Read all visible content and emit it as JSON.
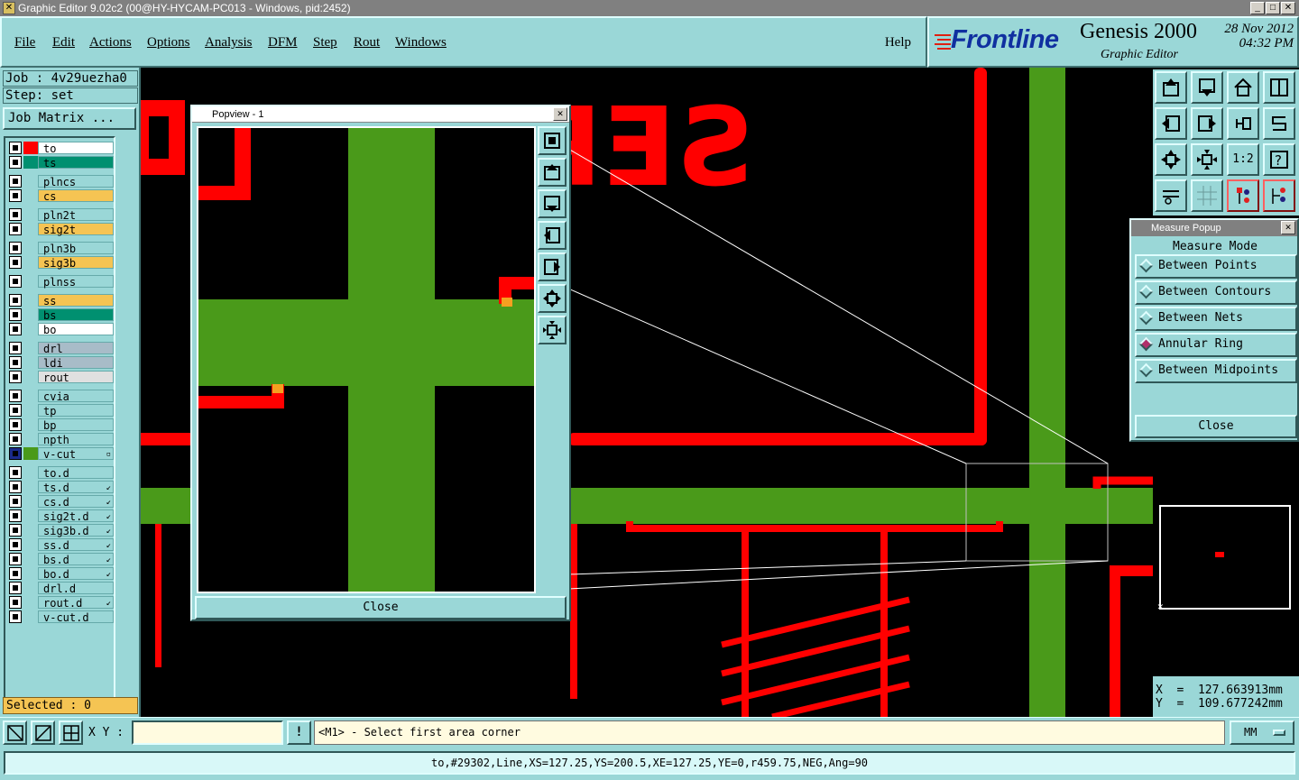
{
  "window": {
    "title": "Graphic Editor 9.02c2 (00@HY-HYCAM-PC013 - Windows, pid:2452)"
  },
  "menu": {
    "items": [
      "File",
      "Edit",
      "Actions",
      "Options",
      "Analysis",
      "DFM",
      "Step",
      "Rout",
      "Windows"
    ],
    "help": "Help"
  },
  "brand": {
    "logo": "Frontline",
    "product": "Genesis 2000",
    "subtitle": "Graphic Editor",
    "date": "28 Nov 2012",
    "time": "04:32 PM"
  },
  "job": {
    "job_line": "Job : 4v29uezha0",
    "step_line": "Step: set",
    "matrix_button": "Job Matrix ..."
  },
  "layers": [
    {
      "name": "to",
      "color": "#ff0000",
      "bg": "#ffffff",
      "mark": ""
    },
    {
      "name": "ts",
      "color": "#009070",
      "bg": "#009070",
      "mark": ""
    },
    {
      "name": "plncs",
      "color": "#9ad7d7",
      "bg": "#9ad7d7",
      "mark": ""
    },
    {
      "name": "cs",
      "color": "#9ad7d7",
      "bg": "#f5c453",
      "mark": ""
    },
    {
      "name": "pln2t",
      "color": "#9ad7d7",
      "bg": "#9ad7d7",
      "mark": ""
    },
    {
      "name": "sig2t",
      "color": "#9ad7d7",
      "bg": "#f5c453",
      "mark": ""
    },
    {
      "name": "pln3b",
      "color": "#9ad7d7",
      "bg": "#9ad7d7",
      "mark": ""
    },
    {
      "name": "sig3b",
      "color": "#9ad7d7",
      "bg": "#f5c453",
      "mark": ""
    },
    {
      "name": "plnss",
      "color": "#9ad7d7",
      "bg": "#9ad7d7",
      "mark": ""
    },
    {
      "name": "ss",
      "color": "#9ad7d7",
      "bg": "#f5c453",
      "mark": ""
    },
    {
      "name": "bs",
      "color": "#9ad7d7",
      "bg": "#009070",
      "mark": ""
    },
    {
      "name": "bo",
      "color": "#9ad7d7",
      "bg": "#ffffff",
      "mark": ""
    },
    {
      "name": "drl",
      "color": "#9ad7d7",
      "bg": "#a8bcc8",
      "mark": ""
    },
    {
      "name": "ldi",
      "color": "#9ad7d7",
      "bg": "#a8bcc8",
      "mark": ""
    },
    {
      "name": "rout",
      "color": "#9ad7d7",
      "bg": "#e0e0e0",
      "mark": ""
    },
    {
      "name": "cvia",
      "color": "#9ad7d7",
      "bg": "#9ad7d7",
      "mark": ""
    },
    {
      "name": "tp",
      "color": "#9ad7d7",
      "bg": "#9ad7d7",
      "mark": ""
    },
    {
      "name": "bp",
      "color": "#9ad7d7",
      "bg": "#9ad7d7",
      "mark": ""
    },
    {
      "name": "npth",
      "color": "#9ad7d7",
      "bg": "#9ad7d7",
      "mark": ""
    },
    {
      "name": "v-cut",
      "color": "#4a9a1a",
      "bg": "#9ad7d7",
      "mark": "▫",
      "active": true
    },
    {
      "name": "to.d",
      "color": "#9ad7d7",
      "bg": "#9ad7d7",
      "mark": ""
    },
    {
      "name": "ts.d",
      "color": "#9ad7d7",
      "bg": "#9ad7d7",
      "mark": "↙"
    },
    {
      "name": "cs.d",
      "color": "#9ad7d7",
      "bg": "#9ad7d7",
      "mark": "↙"
    },
    {
      "name": "sig2t.d",
      "color": "#9ad7d7",
      "bg": "#9ad7d7",
      "mark": "↙"
    },
    {
      "name": "sig3b.d",
      "color": "#9ad7d7",
      "bg": "#9ad7d7",
      "mark": "↙"
    },
    {
      "name": "ss.d",
      "color": "#9ad7d7",
      "bg": "#9ad7d7",
      "mark": "↙"
    },
    {
      "name": "bs.d",
      "color": "#9ad7d7",
      "bg": "#9ad7d7",
      "mark": "↙"
    },
    {
      "name": "bo.d",
      "color": "#9ad7d7",
      "bg": "#9ad7d7",
      "mark": "↙"
    },
    {
      "name": "drl.d",
      "color": "#9ad7d7",
      "bg": "#9ad7d7",
      "mark": ""
    },
    {
      "name": "rout.d",
      "color": "#9ad7d7",
      "bg": "#9ad7d7",
      "mark": "↙"
    },
    {
      "name": "v-cut.d",
      "color": "#9ad7d7",
      "bg": "#9ad7d7",
      "mark": ""
    }
  ],
  "selected_label": "Selected : 0",
  "toolbar": {
    "scale_label": "1:2",
    "help_label": "?"
  },
  "popview": {
    "title": "Popview - 1",
    "close_label": "Close"
  },
  "measure": {
    "title": "Measure Popup",
    "heading": "Measure Mode",
    "options": [
      "Between Points",
      "Between Contours",
      "Between Nets",
      "Annular Ring",
      "Between Midpoints"
    ],
    "selected": "Annular Ring",
    "close_label": "Close"
  },
  "coords": {
    "x": "X  =  127.663913mm",
    "y": "Y  =  109.677242mm"
  },
  "bottom": {
    "xy_label": "X Y :",
    "xy_value": "",
    "bang": "!",
    "prompt": "<M1> - Select first area corner",
    "units": "MM"
  },
  "status": "to,#29302,Line,XS=127.25,YS=200.5,XE=127.25,YE=0,r459.75,NEG,Ang=90",
  "colors": {
    "panel": "#9ad7d7",
    "feature_red": "#ff0000",
    "feature_green": "#4a9a1a",
    "highlight": "#f5c453"
  }
}
